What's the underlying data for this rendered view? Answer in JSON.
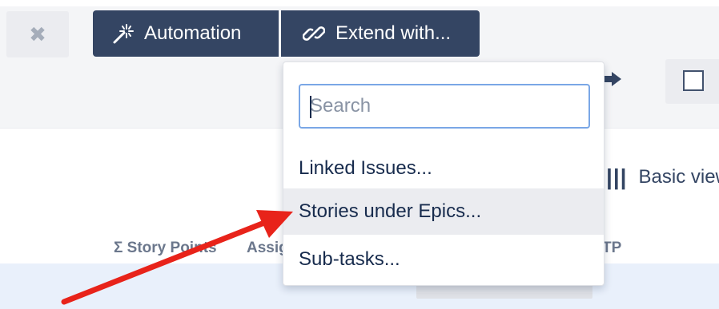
{
  "toolbar": {
    "close_label": "✖",
    "automation_label": "Automation",
    "extend_label": "Extend with...",
    "view_label": "Basic view",
    "view_icon": "|||"
  },
  "columns": [
    {
      "label": "Σ Story Points"
    },
    {
      "label": "Assignee"
    },
    {
      "label": "TP"
    }
  ],
  "dropdown": {
    "search_placeholder": "Search",
    "items": [
      {
        "label": "Linked Issues..."
      },
      {
        "label": "Stories under Epics...",
        "highlighted": true
      },
      {
        "label": "Sub-tasks..."
      }
    ]
  },
  "icons": {
    "close": "close-icon",
    "automation": "magic-wand-icon",
    "extend": "link-icon",
    "arrow": "arrow-right-icon",
    "checkbox": "checkbox-icon",
    "view": "columns-icon"
  },
  "colors": {
    "primary_button": "#344563",
    "annotation_arrow": "#e8231a",
    "search_border": "#7aa7e6",
    "hover_row": "#ebecf0"
  }
}
